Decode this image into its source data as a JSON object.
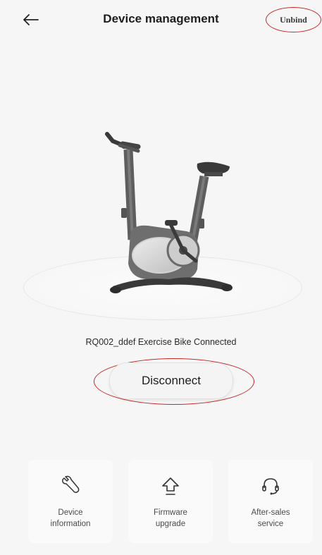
{
  "header": {
    "back_icon": "arrow-left-icon",
    "title": "Device management",
    "unbind_label": "Unbind"
  },
  "device": {
    "image_icon": "exercise-bike-icon",
    "status_text": "RQ002_ddef Exercise Bike Connected",
    "disconnect_label": "Disconnect"
  },
  "actions": [
    {
      "icon": "wrench-icon",
      "label": "Device\ninformation"
    },
    {
      "icon": "upload-arrow-icon",
      "label": "Firmware\nupgrade"
    },
    {
      "icon": "headset-icon",
      "label": "After-sales\nservice"
    }
  ],
  "colors": {
    "background": "#f6f6f6",
    "highlight_ring": "#c62828",
    "card_bg": "#fafafa"
  }
}
